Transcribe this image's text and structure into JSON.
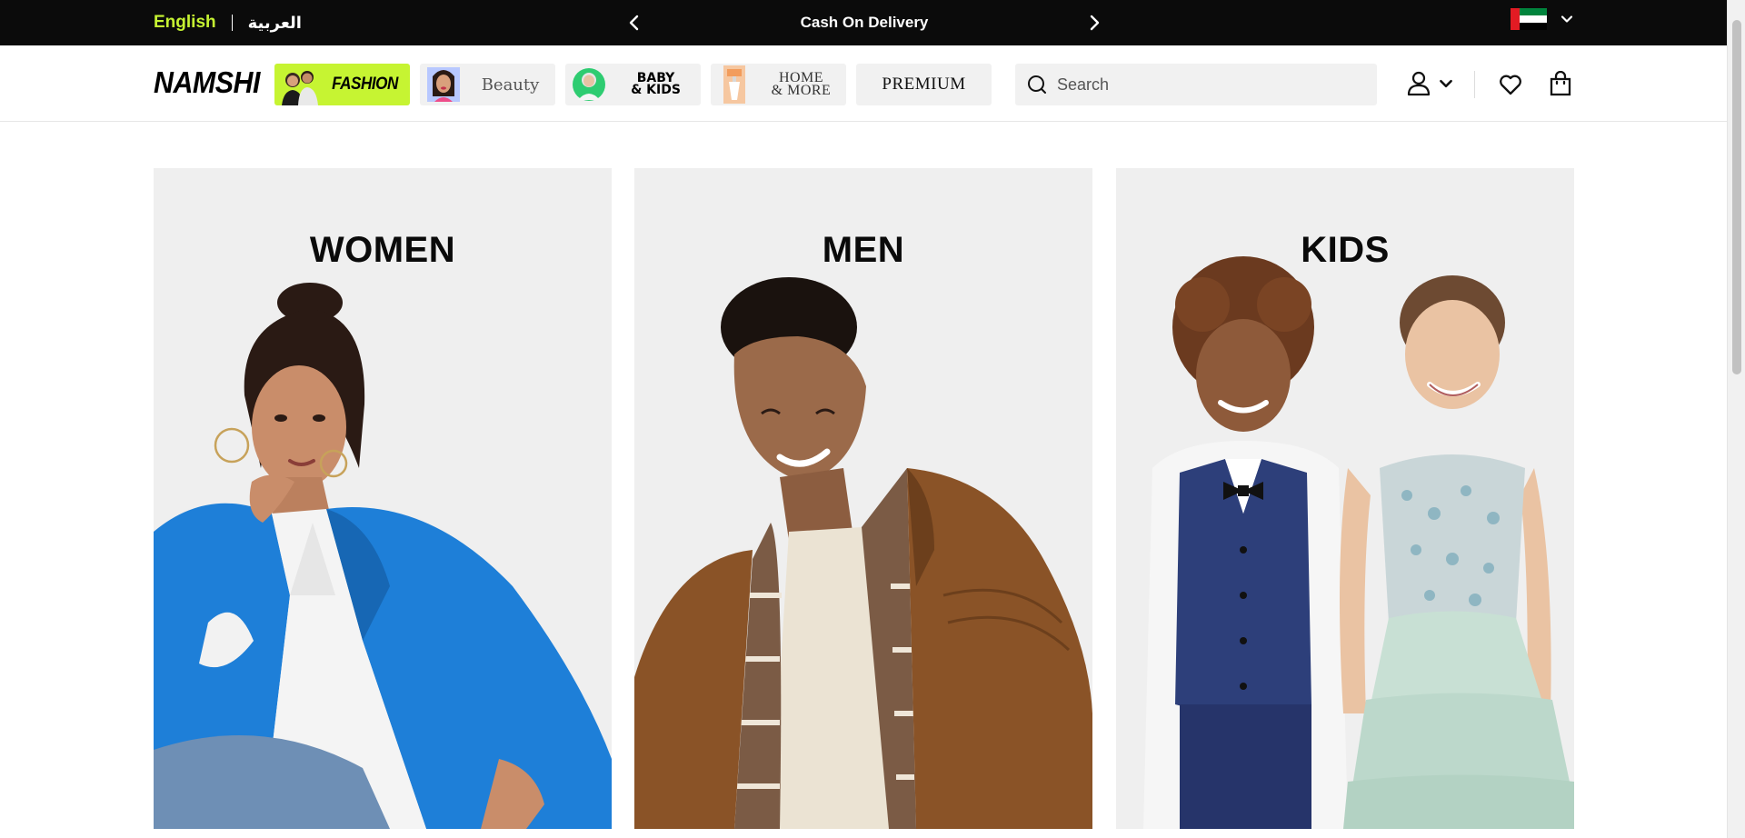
{
  "topbar": {
    "lang_english": "English",
    "lang_arabic": "العربية",
    "promo_text": "Cash On Delivery",
    "country_flag": "uae-flag-icon"
  },
  "header": {
    "logo": "NAMSHI",
    "categories": [
      {
        "label": "FASHION",
        "active": true
      },
      {
        "label": "Beauty",
        "active": false
      },
      {
        "label_line1": "BABY",
        "label_line2": "& KIDS",
        "active": false
      },
      {
        "label_line1": "HOME",
        "label_line2": "& MORE",
        "active": false
      },
      {
        "label": "PREMIUM",
        "active": false
      }
    ],
    "search": {
      "placeholder": "Search",
      "value": ""
    },
    "icons": [
      "user-icon",
      "chevron-down-icon",
      "heart-icon",
      "bag-icon"
    ]
  },
  "hero": {
    "cards": [
      {
        "title": "WOMEN"
      },
      {
        "title": "MEN"
      },
      {
        "title": "KIDS"
      }
    ]
  },
  "colors": {
    "accent": "#c6f432",
    "topbar_bg": "#0b0b0b",
    "card_bg": "#efefef",
    "women_coat": "#1e7fd8",
    "men_jacket": "#8a5327",
    "kids_vest": "#2d3f7a",
    "kids_dress": "#b9d8cc"
  }
}
